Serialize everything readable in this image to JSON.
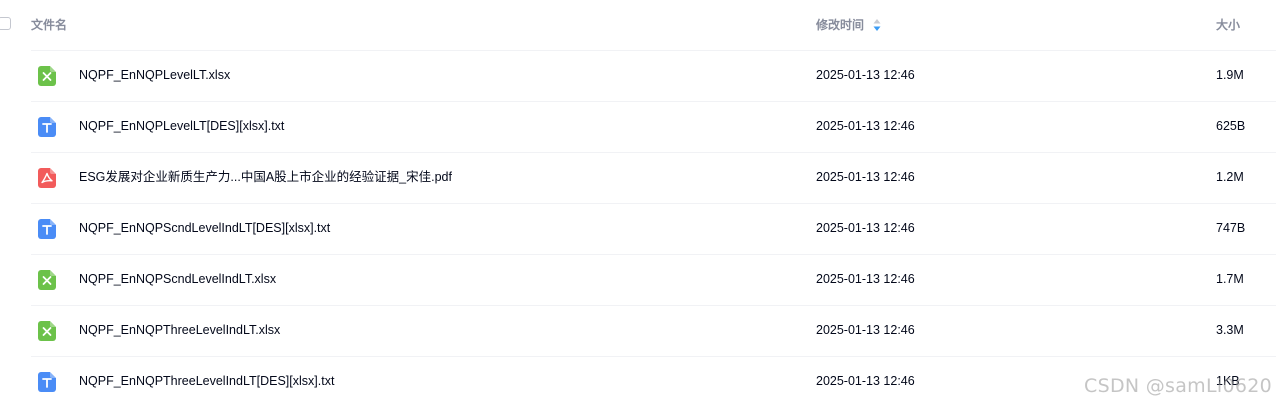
{
  "header": {
    "name_label": "文件名",
    "time_label": "修改时间",
    "size_label": "大小",
    "sort_icon": "sort-icon"
  },
  "colors": {
    "excel": "#6cc24a",
    "text": "#4a8cf6",
    "pdf": "#f25b5b",
    "sort_active": "#3b9cf5"
  },
  "files": [
    {
      "name": "NQPF_EnNQPLevelLT.xlsx",
      "modified": "2025-01-13 12:46",
      "size": "1.9M",
      "icon": "excel-icon"
    },
    {
      "name": "NQPF_EnNQPLevelLT[DES][xlsx].txt",
      "modified": "2025-01-13 12:46",
      "size": "625B",
      "icon": "text-icon"
    },
    {
      "name": "ESG发展对企业新质生产力...中国A股上市企业的经验证据_宋佳.pdf",
      "modified": "2025-01-13 12:46",
      "size": "1.2M",
      "icon": "pdf-icon"
    },
    {
      "name": "NQPF_EnNQPScndLevelIndLT[DES][xlsx].txt",
      "modified": "2025-01-13 12:46",
      "size": "747B",
      "icon": "text-icon"
    },
    {
      "name": "NQPF_EnNQPScndLevelIndLT.xlsx",
      "modified": "2025-01-13 12:46",
      "size": "1.7M",
      "icon": "excel-icon"
    },
    {
      "name": "NQPF_EnNQPThreeLevelIndLT.xlsx",
      "modified": "2025-01-13 12:46",
      "size": "3.3M",
      "icon": "excel-icon"
    },
    {
      "name": "NQPF_EnNQPThreeLevelIndLT[DES][xlsx].txt",
      "modified": "2025-01-13 12:46",
      "size": "1KB",
      "icon": "text-icon"
    }
  ],
  "watermark": "CSDN @samLi0620"
}
